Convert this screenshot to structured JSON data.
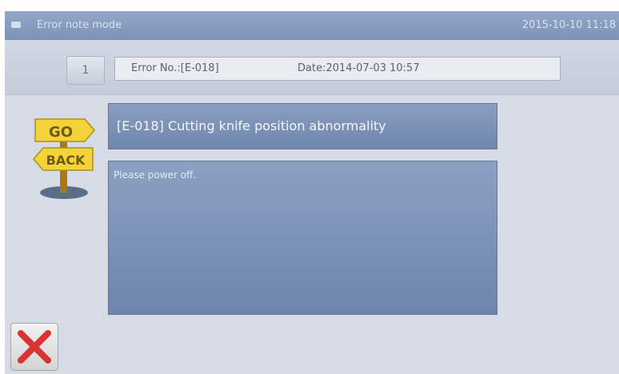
{
  "titlebar": {
    "title": "Error note mode",
    "datetime": "2015-10-10 11:18",
    "icon": "window-icon"
  },
  "toolbar": {
    "page_number": "1",
    "error_no": "Error No.:[E-018]",
    "date": "Date:2014-07-03 10:57"
  },
  "sign": {
    "go": "GO",
    "back": "BACK",
    "icon": "go-back-signpost-icon"
  },
  "error": {
    "title": "[E-018] Cutting knife position abnormality",
    "message": "Please power off."
  },
  "close_button": {
    "icon": "close-x-icon",
    "color": "#d83434"
  }
}
